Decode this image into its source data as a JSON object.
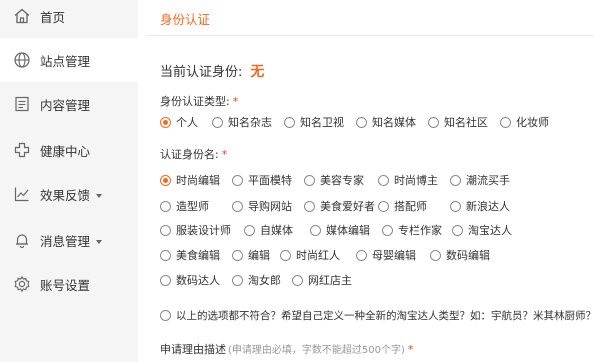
{
  "sidebar": {
    "items": [
      {
        "label": "首页",
        "icon": "home-icon",
        "active": false
      },
      {
        "label": "站点管理",
        "icon": "globe-icon",
        "active": true
      },
      {
        "label": "内容管理",
        "icon": "document-icon",
        "active": false
      },
      {
        "label": "健康中心",
        "icon": "health-cross-icon",
        "active": false
      },
      {
        "label": "效果反馈",
        "icon": "line-chart-icon",
        "active": false,
        "dropdown": true
      },
      {
        "label": "消息管理",
        "icon": "bell-icon",
        "active": false,
        "dropdown": true
      },
      {
        "label": "账号设置",
        "icon": "gear-icon",
        "active": false
      }
    ]
  },
  "main": {
    "page_title": "身份认证",
    "current_label": "当前认证身份:",
    "current_value": "无",
    "identity_type": {
      "label": "身份认证类型:",
      "required_mark": "*",
      "options": [
        "个人",
        "知名杂志",
        "知名卫视",
        "知名媒体",
        "知名社区",
        "化妆师"
      ],
      "selected": 0
    },
    "identity_name": {
      "label": "认证身份名:",
      "required_mark": "*",
      "rows": [
        [
          "时尚编辑",
          "平面模特",
          "美容专家",
          "时尚博主",
          "潮流买手"
        ],
        [
          "造型师",
          "导购网站",
          "美食爱好者",
          "搭配师",
          "新浪达人"
        ],
        [
          "服装设计师",
          "自媒体",
          "媒体编辑",
          "专栏作家",
          "淘宝达人"
        ],
        [
          "美食编辑",
          "编辑",
          "时尚红人",
          "母婴编辑",
          "数码编辑"
        ],
        [
          "数码达人",
          "淘女郎",
          "网红店主"
        ]
      ],
      "selected": "时尚编辑",
      "other_option": "以上的选项都不符合？希望自己定义一种全新的淘宝达人类型？如：宇航员？米其林厨师？"
    },
    "reason": {
      "label": "申请理由描述",
      "hint": "(申请理由必填，字数不能超过500个字)",
      "required_mark": "*"
    }
  },
  "colors": {
    "accent": "#f26a21",
    "sidebar_bg": "#f5f5f5",
    "required": "#e8432c"
  }
}
